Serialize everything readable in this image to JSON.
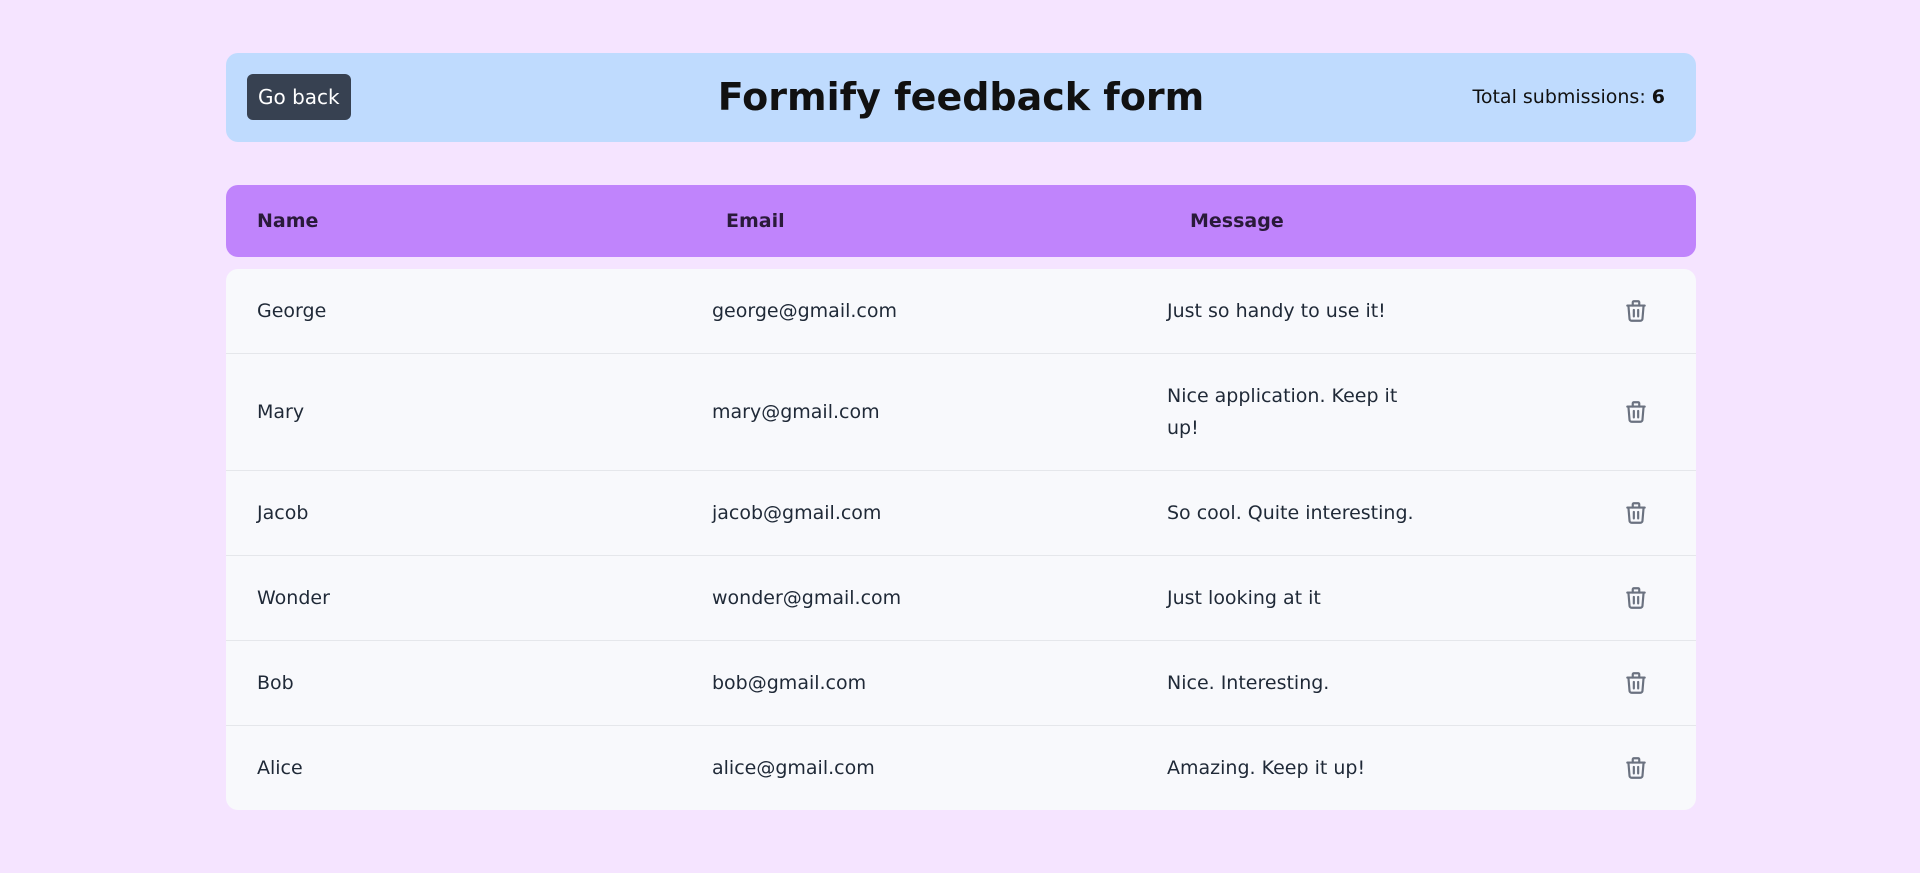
{
  "header": {
    "back_label": "Go back",
    "title": "Formify feedback form",
    "total_label": "Total submissions:",
    "total_count": "6"
  },
  "table": {
    "columns": [
      "Name",
      "Email",
      "Message"
    ],
    "rows": [
      {
        "name": "George",
        "email": "george@gmail.com",
        "message": "Just so handy to use it!"
      },
      {
        "name": "Mary",
        "email": "mary@gmail.com",
        "message": "Nice application. Keep it up!"
      },
      {
        "name": "Jacob",
        "email": "jacob@gmail.com",
        "message": "So cool. Quite interesting."
      },
      {
        "name": "Wonder",
        "email": "wonder@gmail.com",
        "message": "Just looking at it"
      },
      {
        "name": "Bob",
        "email": "bob@gmail.com",
        "message": "Nice. Interesting."
      },
      {
        "name": "Alice",
        "email": "alice@gmail.com",
        "message": "Amazing. Keep it up!"
      }
    ],
    "delete_icon": "trash-icon"
  },
  "colors": {
    "background": "#f5e4ff",
    "header_bg": "#bfdbfe",
    "table_header_bg": "#c084fc",
    "button_bg": "#374151",
    "icon_color": "#6b7280"
  }
}
